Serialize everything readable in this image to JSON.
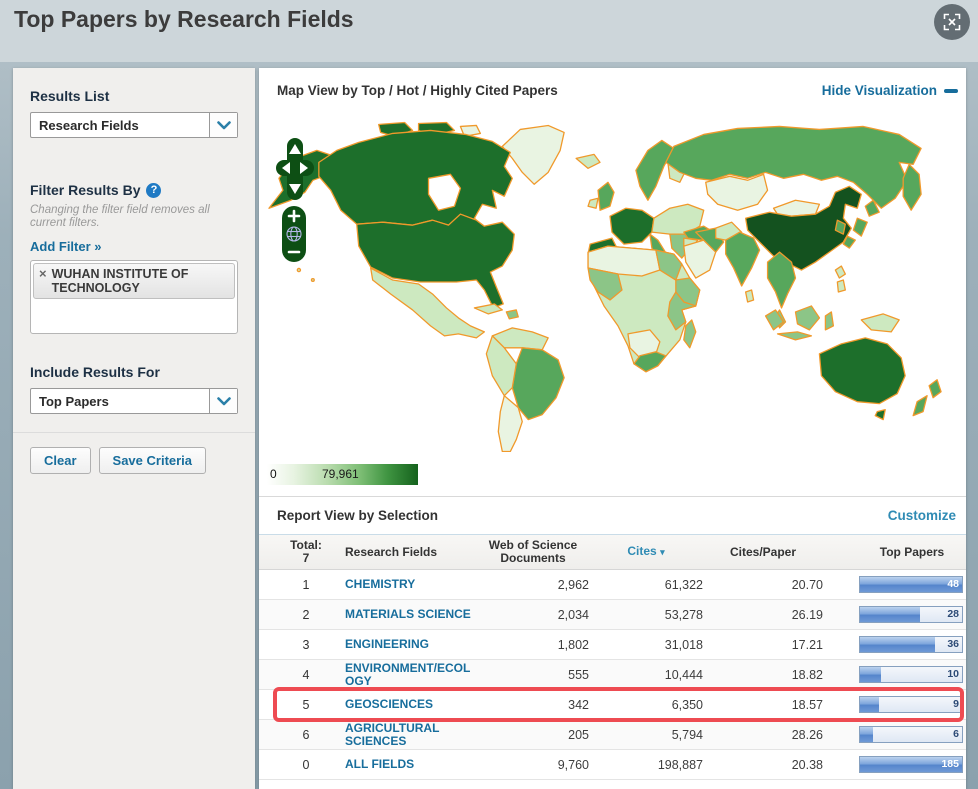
{
  "page": {
    "title": "Top Papers by Research Fields"
  },
  "sidebar": {
    "results_list_label": "Results List",
    "results_list_value": "Research Fields",
    "filter_label": "Filter Results By",
    "filter_note": "Changing the filter field removes all current filters.",
    "add_filter_label": "Add Filter »",
    "filter_tag": {
      "remove": "×",
      "label": "WUHAN INSTITUTE OF TECHNOLOGY"
    },
    "include_label": "Include Results For",
    "include_value": "Top Papers",
    "clear_button": "Clear",
    "save_button": "Save Criteria"
  },
  "map": {
    "title": "Map View by Top / Hot / Highly Cited Papers",
    "hide_link": "Hide Visualization",
    "legend_min": "0",
    "legend_max": "79,961",
    "zoom_in": "+",
    "zoom_out": "−"
  },
  "report": {
    "title": "Report View by Selection",
    "customize_link": "Customize",
    "table": {
      "total_label": "Total:",
      "total_value": "7",
      "columns": [
        "Research Fields",
        "Web of Science Documents",
        "Cites",
        "Cites/Paper",
        "Top Papers"
      ],
      "sort_indicator": "▾",
      "rows": [
        {
          "rank": "1",
          "field": "CHEMISTRY",
          "docs": "2,962",
          "cites": "61,322",
          "cpp": "20.70",
          "top": "48",
          "bar_pct": 100,
          "bar_full": true,
          "highlighted": false
        },
        {
          "rank": "2",
          "field": "MATERIALS SCIENCE",
          "docs": "2,034",
          "cites": "53,278",
          "cpp": "26.19",
          "top": "28",
          "bar_pct": 59,
          "bar_full": false,
          "highlighted": false
        },
        {
          "rank": "3",
          "field": "ENGINEERING",
          "docs": "1,802",
          "cites": "31,018",
          "cpp": "17.21",
          "top": "36",
          "bar_pct": 74,
          "bar_full": false,
          "highlighted": false
        },
        {
          "rank": "4",
          "field": "ENVIRONMENT/ECOLOGY",
          "docs": "555",
          "cites": "10,444",
          "cpp": "18.82",
          "top": "10",
          "bar_pct": 21,
          "bar_full": false,
          "highlighted": false
        },
        {
          "rank": "5",
          "field": "GEOSCIENCES",
          "docs": "342",
          "cites": "6,350",
          "cpp": "18.57",
          "top": "9",
          "bar_pct": 19,
          "bar_full": false,
          "highlighted": true
        },
        {
          "rank": "6",
          "field": "AGRICULTURAL SCIENCES",
          "docs": "205",
          "cites": "5,794",
          "cpp": "28.26",
          "top": "6",
          "bar_pct": 13,
          "bar_full": false,
          "highlighted": false
        },
        {
          "rank": "0",
          "field": "ALL FIELDS",
          "docs": "9,760",
          "cites": "198,887",
          "cpp": "20.38",
          "top": "185",
          "bar_pct": 100,
          "bar_full": true,
          "highlighted": false
        }
      ]
    }
  },
  "colors": {
    "accent_link": "#176d9c",
    "cites_sort": "#2f8bb4",
    "highlight_box": "#ee4b52",
    "map_stroke": "#f0992b",
    "map_dark": "#1d6f2b",
    "map_darkest": "#14521f",
    "map_medium": "#57a75c",
    "map_medlight": "#8cc587",
    "map_light": "#cde9c0",
    "map_pale": "#e9f4e2",
    "control_green": "#0d4f14"
  }
}
